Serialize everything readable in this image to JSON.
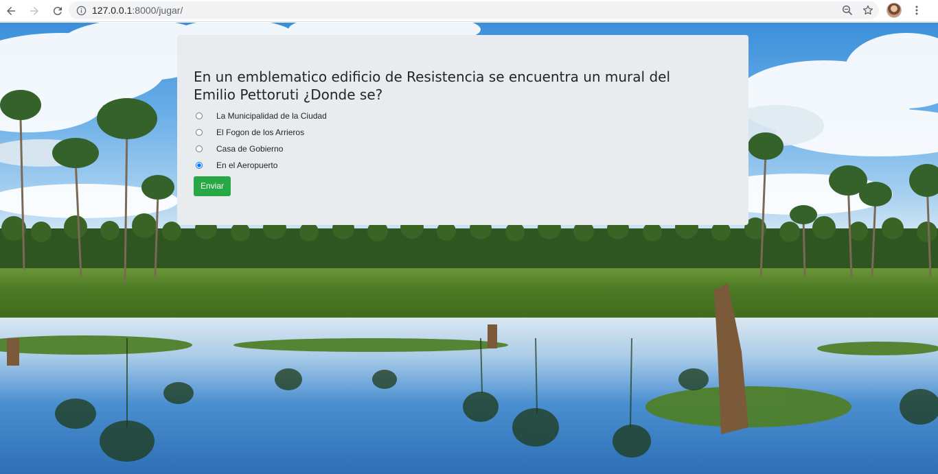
{
  "browser": {
    "url_host": "127.0.0.1",
    "url_rest": ":8000/jugar/"
  },
  "quiz": {
    "question": "En un emblematico edificio de Resistencia se encuentra un mural del Emilio Pettoruti ¿Donde se?",
    "options": [
      {
        "label": "La Municipalidad de la Ciudad",
        "selected": false
      },
      {
        "label": "El Fogon de los Arrieros",
        "selected": false
      },
      {
        "label": "Casa de Gobierno",
        "selected": false
      },
      {
        "label": "En el Aeropuerto",
        "selected": true
      }
    ],
    "submit_label": "Enviar"
  },
  "colors": {
    "card_bg": "#e9ecef",
    "button_bg": "#28a745",
    "radio_checked": "#0075ff"
  }
}
